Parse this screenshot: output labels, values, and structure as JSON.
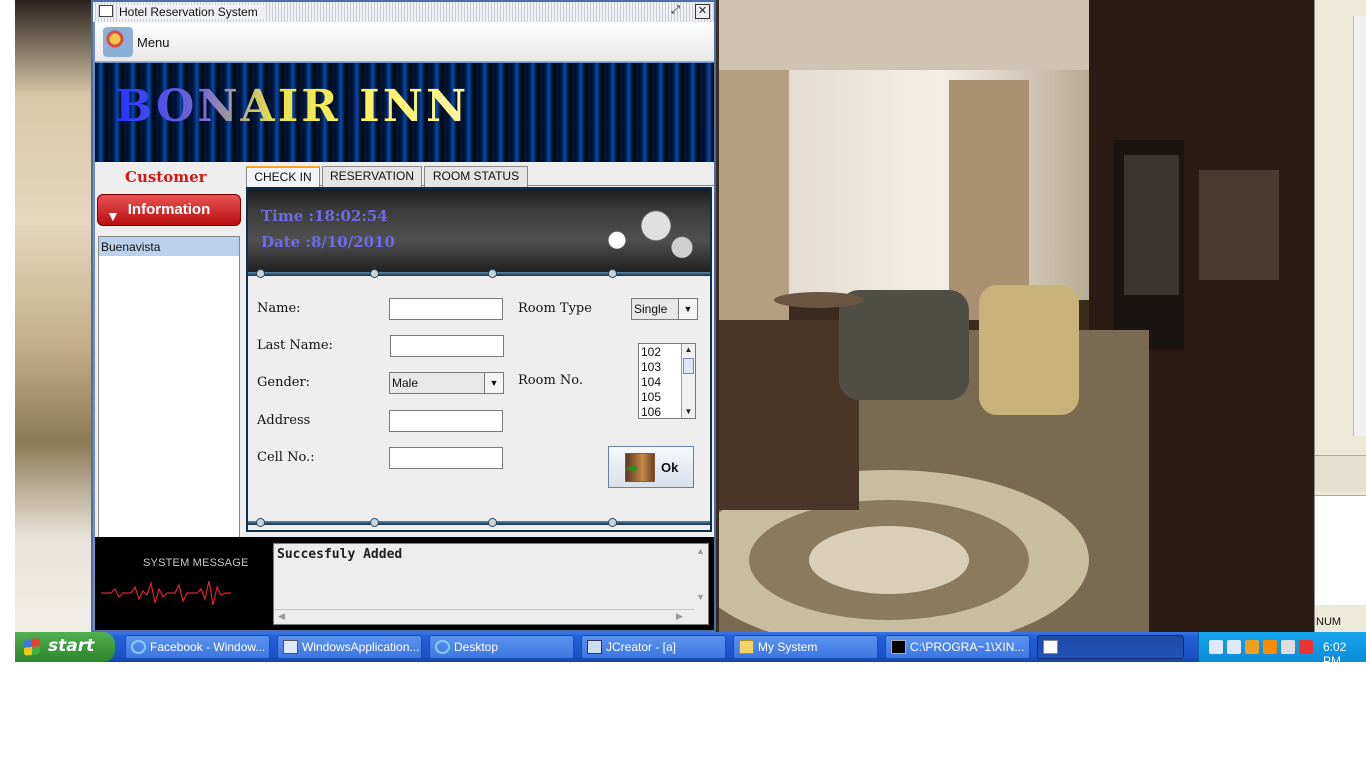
{
  "window": {
    "title": "Hotel Reservation System",
    "restore_glyph": "⤢",
    "close_glyph": "✕"
  },
  "menu": {
    "label": "Menu"
  },
  "banner": {
    "title": "BONAIR INN"
  },
  "sidebar": {
    "heading": "Customer",
    "info_button": "Information",
    "customers": [
      "Buenavista"
    ]
  },
  "tabs": [
    {
      "label": "CHECK IN",
      "active": true
    },
    {
      "label": "RESERVATION",
      "active": false
    },
    {
      "label": "ROOM STATUS",
      "active": false
    }
  ],
  "clock_panel": {
    "time": "Time :18:02:54",
    "date": "Date :8/10/2010"
  },
  "form": {
    "name_label": "Name:",
    "last_name_label": "Last Name:",
    "gender_label": "Gender:",
    "address_label": "Address",
    "cell_label": "Cell No.:",
    "room_type_label": "Room Type",
    "room_no_label": "Room No.",
    "name_value": "",
    "last_name_value": "",
    "address_value": "",
    "cell_value": "",
    "gender_selected": "Male",
    "room_type_selected": "Single",
    "room_numbers": [
      "102",
      "103",
      "104",
      "105",
      "106"
    ],
    "ok_label": "Ok"
  },
  "system_message": {
    "title": "SYSTEM MESSAGE",
    "text": "Succesfuly Added"
  },
  "taskbar": {
    "start_label": "start",
    "tasks": [
      {
        "label": "Facebook - Window...",
        "icon": "ie-icon"
      },
      {
        "label": "WindowsApplication...",
        "icon": "vb-icon"
      },
      {
        "label": "Desktop",
        "icon": "ie-icon"
      },
      {
        "label": "JCreator - [a]",
        "icon": "jcreator-icon"
      },
      {
        "label": "My System",
        "icon": "folder-icon"
      },
      {
        "label": "C:\\PROGRA~1\\XIN...",
        "icon": "console-icon"
      },
      {
        "label": "",
        "icon": "java-icon"
      }
    ],
    "clock": "6:02 PM",
    "num_indicator": "NUM"
  },
  "colors": {
    "window_border": "#4d6ea8",
    "heading_red": "#d01a1a",
    "clock_text": "#6d6be6",
    "taskbar_blue": "#2560d8",
    "start_green": "#3c9a3c"
  }
}
